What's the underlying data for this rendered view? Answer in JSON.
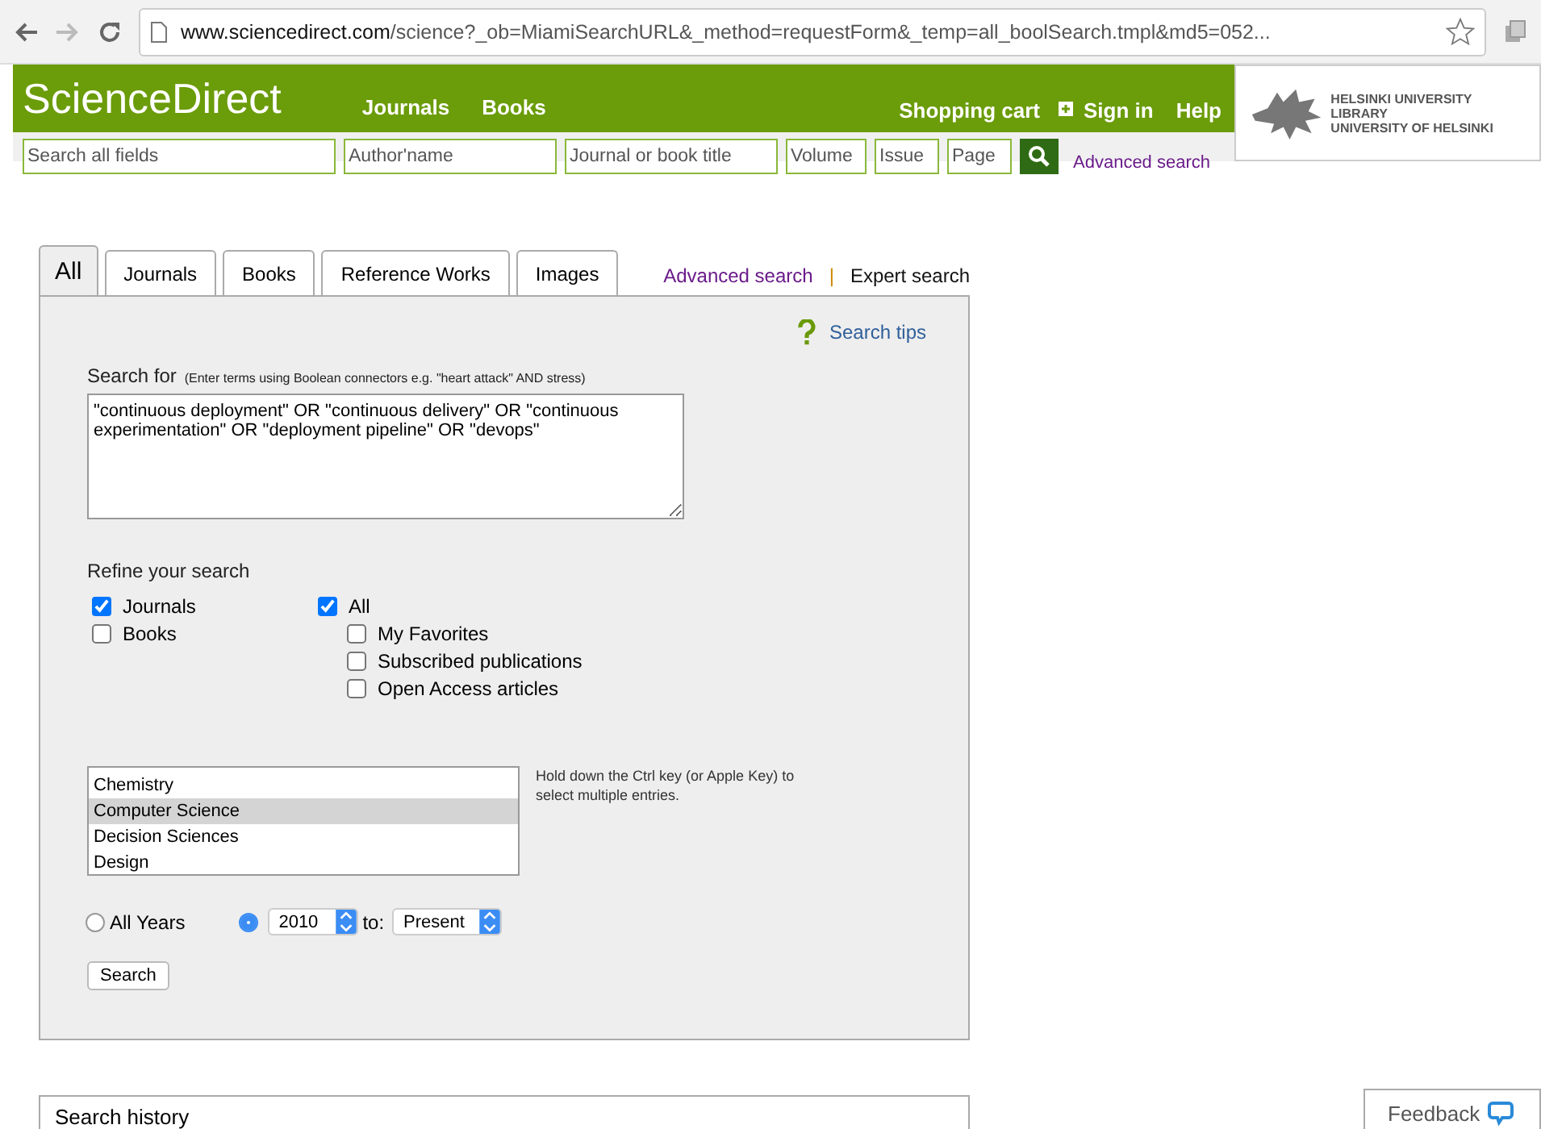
{
  "browser": {
    "url_host": "www.sciencedirect.com",
    "url_path": "/science?_ob=MiamiSearchURL&_method=requestForm&_temp=all_boolSearch.tmpl&md5=052..."
  },
  "header": {
    "logo": "ScienceDirect",
    "nav": [
      "Journals",
      "Books"
    ],
    "right_links": [
      {
        "label": "Shopping cart",
        "kind": "plain"
      },
      {
        "label": "Sign in",
        "kind": "plus"
      },
      {
        "label": "Help",
        "kind": "plain"
      }
    ],
    "library": [
      "HELSINKI UNIVERSITY LIBRARY",
      "UNIVERSITY OF HELSINKI"
    ]
  },
  "quick_search": {
    "fields": [
      {
        "placeholder": "Search all fields"
      },
      {
        "placeholder": "Author'name"
      },
      {
        "placeholder": "Journal or book title"
      },
      {
        "placeholder": "Volume"
      },
      {
        "placeholder": "Issue"
      },
      {
        "placeholder": "Page"
      }
    ],
    "advanced_link": "Advanced search"
  },
  "tabs": [
    {
      "label": "All",
      "selected": true
    },
    {
      "label": "Journals",
      "selected": false
    },
    {
      "label": "Books",
      "selected": false
    },
    {
      "label": "Reference Works",
      "selected": false
    },
    {
      "label": "Images",
      "selected": false
    }
  ],
  "search_modes": [
    {
      "label": "Advanced search",
      "selected": false
    },
    {
      "label": "Expert search",
      "selected": true
    }
  ],
  "separator": "|",
  "search_tips": "Search tips",
  "search_for": {
    "label": "Search for",
    "hint": "(Enter terms using Boolean connectors e.g. \"heart attack\" AND stress)",
    "value": "\"continuous deployment\" OR \"continuous delivery\" OR \"continuous experimentation\" OR \"deployment pipeline\" OR \"devops\""
  },
  "refine": {
    "label": "Refine your search",
    "sources": [
      {
        "label": "Journals",
        "checked": true
      },
      {
        "label": "Books",
        "checked": false
      }
    ],
    "access": {
      "label": "All",
      "checked": true,
      "children": [
        {
          "label": "My Favorites",
          "checked": false
        },
        {
          "label": "Subscribed publications",
          "checked": false
        },
        {
          "label": "Open Access articles",
          "checked": false
        }
      ]
    }
  },
  "subjects": [
    {
      "label": "Chemistry",
      "selected": false
    },
    {
      "label": "Computer Science",
      "selected": true
    },
    {
      "label": "Decision Sciences",
      "selected": false
    },
    {
      "label": "Design",
      "selected": false
    }
  ],
  "subjects_hint": "Hold down the Ctrl key (or Apple Key) to select multiple entries.",
  "years": {
    "all_years": {
      "label": "All Years",
      "selected": false
    },
    "range": {
      "selected": true,
      "from": "2010",
      "to_label": "to:",
      "to": "Present"
    }
  },
  "search_button": "Search",
  "search_history": "Search history",
  "feedback": "Feedback"
}
